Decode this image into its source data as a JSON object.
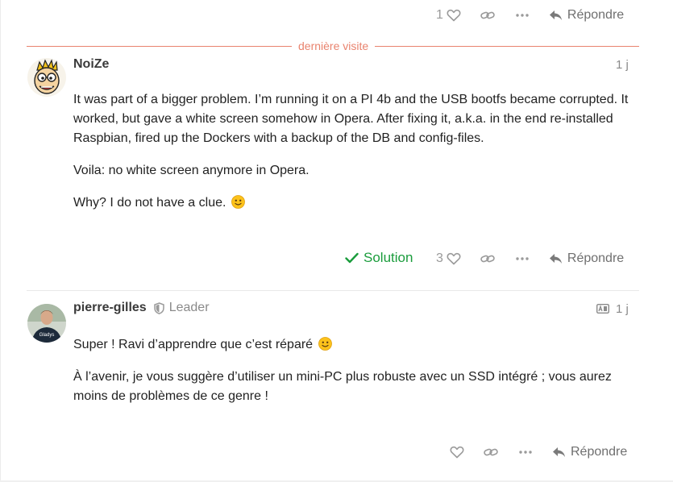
{
  "top_actions": {
    "like_count": "1",
    "reply_label": "Répondre"
  },
  "divider": {
    "label": "dernière visite"
  },
  "post1": {
    "username": "NoiZe",
    "date": "1 j",
    "paragraphs": [
      "It was part of a bigger problem. I’m running it on a PI 4b and the USB bootfs became corrupted. It worked, but gave a white screen somehow in Opera. After fixing it, a.k.a. in the end re-installed Raspbian, fired up the Dockers with a backup of the DB and config-files.",
      "Voila: no white screen anymore in Opera.",
      "Why? I do not have a clue."
    ],
    "solution_label": "Solution",
    "like_count": "3",
    "reply_label": "Répondre"
  },
  "post2": {
    "username": "pierre-gilles",
    "flair_title": "Leader",
    "date": "1 j",
    "avatar_shirt_text": "Gladys",
    "paragraphs": [
      "Super ! Ravi d’apprendre que c’est réparé",
      "À l’avenir, je vous suggère d’utiliser un mini-PC plus robuste avec un SSD intégré ; vous aurez moins de problèmes de ce genre !"
    ],
    "reply_label": "Répondre"
  },
  "colors": {
    "accent": "#e9836e",
    "solution": "#1a9c3c",
    "muted": "#8a8a8a",
    "text": "#222222"
  },
  "icons": [
    "heart-icon",
    "link-icon",
    "ellipsis-icon",
    "reply-icon",
    "check-icon",
    "shield-icon",
    "translate-icon",
    "slight-smile-emoji"
  ]
}
